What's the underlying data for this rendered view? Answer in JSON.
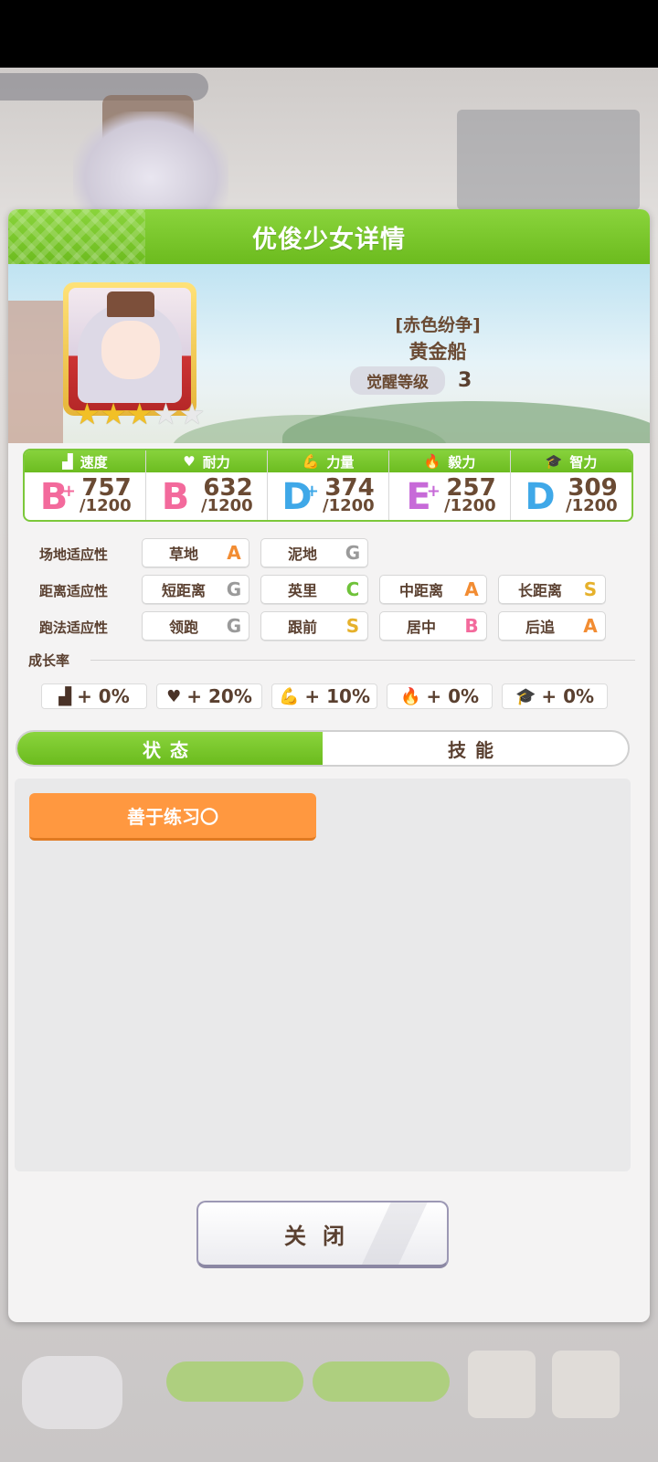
{
  "background": {
    "top_pill_text": "",
    "bottom_buttons": [
      "",
      "",
      ""
    ]
  },
  "dialog": {
    "title": "优俊少女详情",
    "character": {
      "epithet": "[赤色纷争]",
      "name": "黄金船",
      "awaken_label": "觉醒等级",
      "awaken_level": "3",
      "stars_total": 5,
      "stars_filled": 3
    },
    "stats": [
      {
        "label": "速度",
        "icon": "shoe-icon",
        "grade": "B",
        "plus": "+",
        "value": "757",
        "max": "/1200"
      },
      {
        "label": "耐力",
        "icon": "heart-icon",
        "grade": "B",
        "plus": "",
        "value": "632",
        "max": "/1200"
      },
      {
        "label": "力量",
        "icon": "muscle-icon",
        "grade": "D",
        "plus": "+",
        "value": "374",
        "max": "/1200"
      },
      {
        "label": "毅力",
        "icon": "flame-icon",
        "grade": "E",
        "plus": "+",
        "value": "257",
        "max": "/1200"
      },
      {
        "label": "智力",
        "icon": "graduation-cap-icon",
        "grade": "D",
        "plus": "",
        "value": "309",
        "max": "/1200"
      }
    ],
    "aptitude": {
      "field": {
        "label": "场地适应性",
        "items": [
          {
            "name": "草地",
            "grade": "A"
          },
          {
            "name": "泥地",
            "grade": "G"
          }
        ]
      },
      "distance": {
        "label": "距离适应性",
        "items": [
          {
            "name": "短距离",
            "grade": "G"
          },
          {
            "name": "英里",
            "grade": "C"
          },
          {
            "name": "中距离",
            "grade": "A"
          },
          {
            "name": "长距离",
            "grade": "S"
          }
        ]
      },
      "style": {
        "label": "跑法适应性",
        "items": [
          {
            "name": "领跑",
            "grade": "G"
          },
          {
            "name": "跟前",
            "grade": "S"
          },
          {
            "name": "居中",
            "grade": "B"
          },
          {
            "name": "后追",
            "grade": "A"
          }
        ]
      }
    },
    "growth": {
      "title": "成长率",
      "items": [
        {
          "icon": "shoe-icon",
          "value": "+ 0%"
        },
        {
          "icon": "heart-icon",
          "value": "+ 20%"
        },
        {
          "icon": "muscle-icon",
          "value": "+ 10%"
        },
        {
          "icon": "flame-icon",
          "value": "+ 0%"
        },
        {
          "icon": "graduation-cap-icon",
          "value": "+ 0%"
        }
      ]
    },
    "tabs": [
      {
        "label": "状态",
        "active": true
      },
      {
        "label": "技能",
        "active": false
      }
    ],
    "status_chip": "善于练习〇",
    "close_button": "关闭"
  },
  "colors": {
    "header_green": "#6cbb1e",
    "chip_orange": "#ff9840",
    "text_brown": "#5a4030"
  }
}
